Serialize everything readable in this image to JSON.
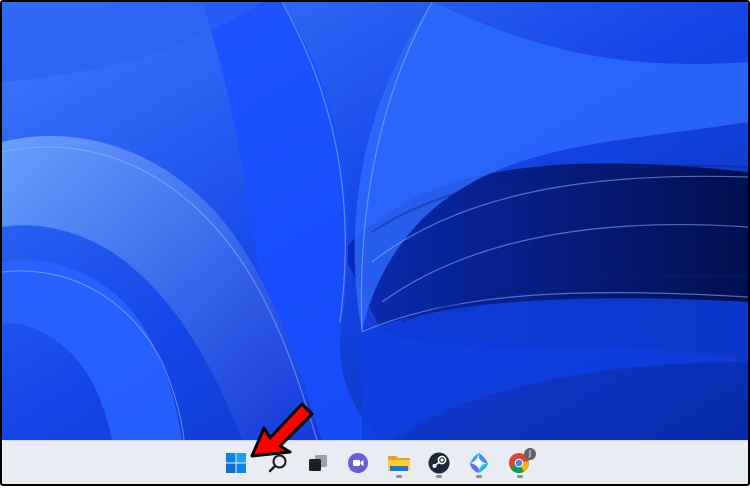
{
  "wallpaper": {
    "name": "bloom-wallpaper",
    "colors": [
      "#0a2fd9",
      "#1e5bff",
      "#4f86ff",
      "#021b8a",
      "#6aa2ff"
    ]
  },
  "taskbar": {
    "background": "#e9ecf3",
    "items": [
      {
        "name": "start-button",
        "icon": "windows-logo-icon",
        "running": false
      },
      {
        "name": "search-button",
        "icon": "search-icon",
        "running": false
      },
      {
        "name": "task-view-button",
        "icon": "task-view-icon",
        "running": false
      },
      {
        "name": "teams-chat-button",
        "icon": "chat-icon",
        "running": false
      },
      {
        "name": "file-explorer-button",
        "icon": "folder-icon",
        "running": true
      },
      {
        "name": "steam-button",
        "icon": "steam-icon",
        "running": true
      },
      {
        "name": "photos-button",
        "icon": "photos-icon",
        "running": true
      },
      {
        "name": "chrome-button",
        "icon": "chrome-icon",
        "running": true,
        "profile_badge": "J"
      }
    ]
  },
  "annotation": {
    "type": "arrow",
    "color": "#ff0000",
    "points_to": "start-button"
  }
}
